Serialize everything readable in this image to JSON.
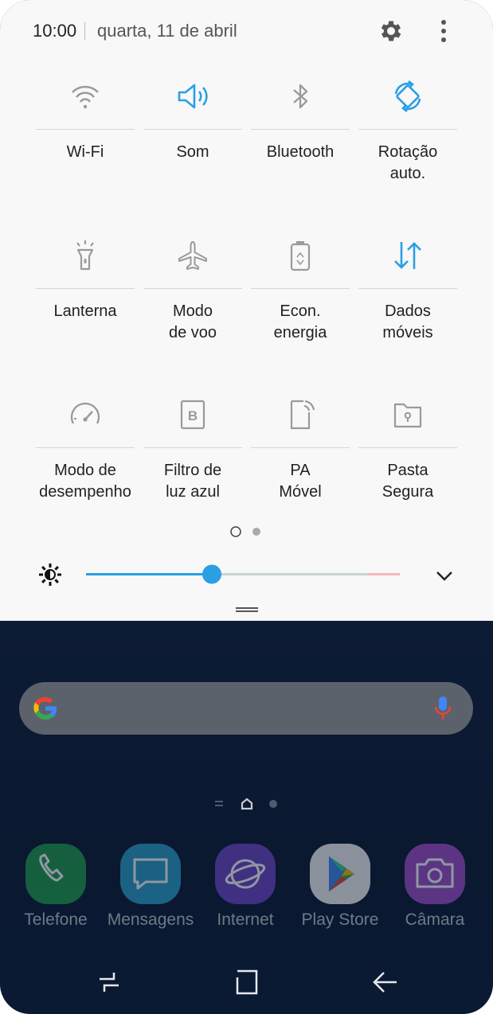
{
  "status": {
    "time": "10:00",
    "date": "quarta, 11 de abril"
  },
  "tiles": [
    {
      "label": "Wi-Fi",
      "icon": "wifi-icon",
      "active": false
    },
    {
      "label": "Som",
      "icon": "volume-icon",
      "active": true
    },
    {
      "label": "Bluetooth",
      "icon": "bluetooth-icon",
      "active": false
    },
    {
      "label": "Rotação\nauto.",
      "icon": "auto-rotate-icon",
      "active": true
    },
    {
      "label": "Lanterna",
      "icon": "flashlight-icon",
      "active": false
    },
    {
      "label": "Modo\nde voo",
      "icon": "airplane-icon",
      "active": false
    },
    {
      "label": "Econ.\nenergia",
      "icon": "power-saving-icon",
      "active": false
    },
    {
      "label": "Dados\nmóveis",
      "icon": "mobile-data-icon",
      "active": true
    },
    {
      "label": "Modo de\ndesempenho",
      "icon": "performance-gauge-icon",
      "active": false
    },
    {
      "label": "Filtro de\nluz azul",
      "icon": "blue-light-filter-icon",
      "active": false
    },
    {
      "label": "PA\nMóvel",
      "icon": "mobile-hotspot-icon",
      "active": false
    },
    {
      "label": "Pasta\nSegura",
      "icon": "secure-folder-icon",
      "active": false
    }
  ],
  "brightness": {
    "level": 0.4
  },
  "colors": {
    "accent": "#2a9fe4",
    "inactive_icon": "#9a9a9a"
  },
  "dock": {
    "apps": [
      {
        "label": "Telefone",
        "icon": "phone-icon",
        "color": "#1e9a4a"
      },
      {
        "label": "Mensagens",
        "icon": "messages-icon",
        "color": "#2a9ec8"
      },
      {
        "label": "Internet",
        "icon": "internet-icon",
        "color": "#6c45c6"
      },
      {
        "label": "Play Store",
        "icon": "play-store-icon",
        "color": "#f5f5f5"
      },
      {
        "label": "Câmara",
        "icon": "camera-icon",
        "color": "#a04cc8"
      }
    ]
  }
}
